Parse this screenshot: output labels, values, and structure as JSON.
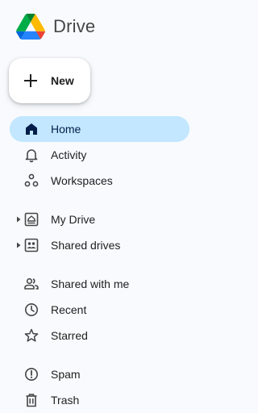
{
  "app": {
    "title": "Drive",
    "logo_icon": "google-drive-logo-icon"
  },
  "new_button": {
    "label": "New",
    "icon": "plus-icon"
  },
  "nav": {
    "items": [
      {
        "label": "Home",
        "icon": "home-icon",
        "active": true
      },
      {
        "label": "Activity",
        "icon": "bell-icon"
      },
      {
        "label": "Workspaces",
        "icon": "workspaces-icon"
      },
      {
        "label": "My Drive",
        "icon": "my-drive-icon",
        "expandable": true
      },
      {
        "label": "Shared drives",
        "icon": "shared-drives-icon",
        "expandable": true
      },
      {
        "label": "Shared with me",
        "icon": "people-icon"
      },
      {
        "label": "Recent",
        "icon": "clock-icon"
      },
      {
        "label": "Starred",
        "icon": "star-icon"
      },
      {
        "label": "Spam",
        "icon": "spam-icon"
      },
      {
        "label": "Trash",
        "icon": "trash-icon"
      }
    ]
  },
  "colors": {
    "background": "#f8fafd",
    "active_item": "#c2e7ff",
    "active_text": "#041e49",
    "text": "#1f1f1f"
  }
}
